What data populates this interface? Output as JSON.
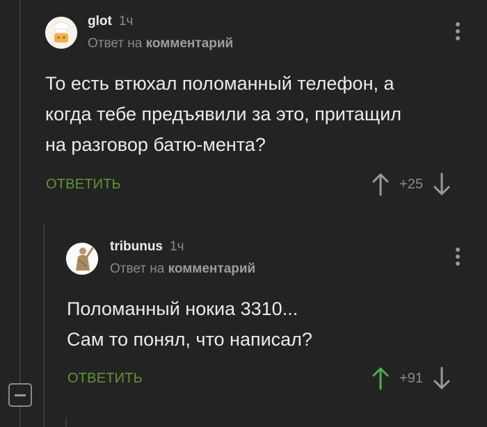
{
  "comments": [
    {
      "username": "glot",
      "time": "1ч",
      "reply_prefix": "Ответ на",
      "reply_link": "комментарий",
      "text_lines": [
        "То есть втюхал поломанный телефон, а",
        "когда тебе предъявили за это, притащил",
        "на разговор батю-мента?"
      ],
      "reply_label": "ОТВЕТИТЬ",
      "score": "+25"
    },
    {
      "username": "tribunus",
      "time": "1ч",
      "reply_prefix": "Ответ на",
      "reply_link": "комментарий",
      "text_lines": [
        "Поломанный нокиа 3310...",
        "Сам то понял, что написал?"
      ],
      "reply_label": "ОТВЕТИТЬ",
      "score": "+91"
    }
  ],
  "colors": {
    "background": "#232323",
    "reply_green": "#5e9632",
    "upvoted_green": "#4caf50",
    "muted": "#8a8a8a"
  },
  "icons": [
    "chef-hat-avatar-icon",
    "statue-avatar-icon",
    "more-vertical-icon",
    "arrow-up-icon",
    "arrow-down-icon",
    "collapse-icon"
  ]
}
